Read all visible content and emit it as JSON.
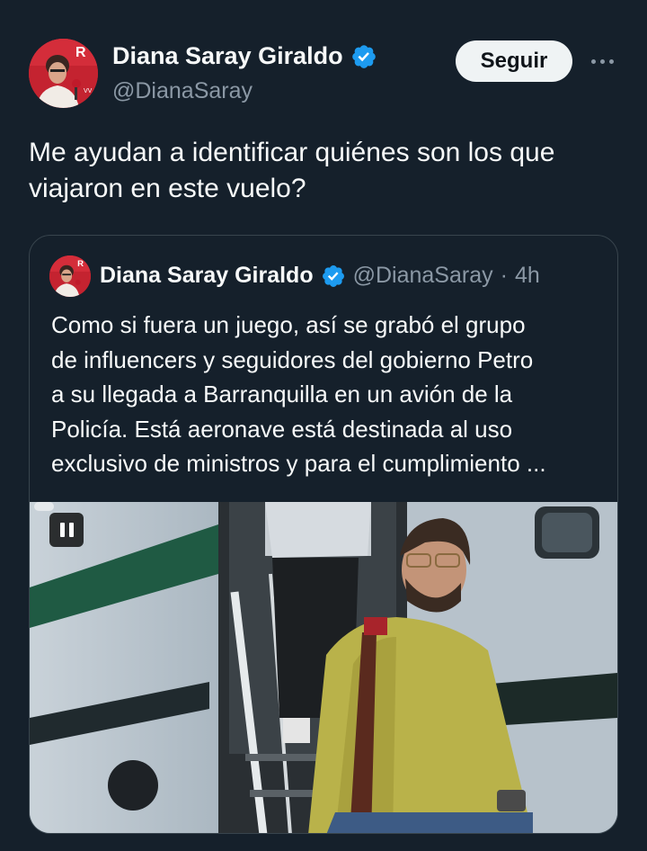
{
  "tweet": {
    "author_name": "Diana Saray Giraldo",
    "author_handle": "@DianaSaray",
    "follow_label": "Seguir",
    "more_icon": "more-horizontal-icon",
    "verified_icon": "verified-badge-icon",
    "text_lines": [
      "Me ayudan a identificar quiénes son los que",
      "viajaron en este vuelo?"
    ]
  },
  "quoted_tweet": {
    "author_name": "Diana Saray Giraldo",
    "author_handle": "@DianaSaray",
    "separator": "·",
    "time": "4h",
    "text_lines": [
      "Como si fuera un juego, así se grabó el grupo",
      "de influencers y seguidores  del gobierno Petro",
      "a su llegada a Barranquilla en un avión de la",
      "Policía. Está aeronave está destinada al uso",
      "exclusivo de ministros y para el cumplimiento ..."
    ],
    "media": {
      "type": "video",
      "state": "playing",
      "control_icon": "pause-icon"
    }
  },
  "colors": {
    "background": "#15202b",
    "verified": "#1d9bf0",
    "secondary_text": "#8b98a5",
    "border": "#38444d",
    "follow_button": "#eff3f4"
  }
}
